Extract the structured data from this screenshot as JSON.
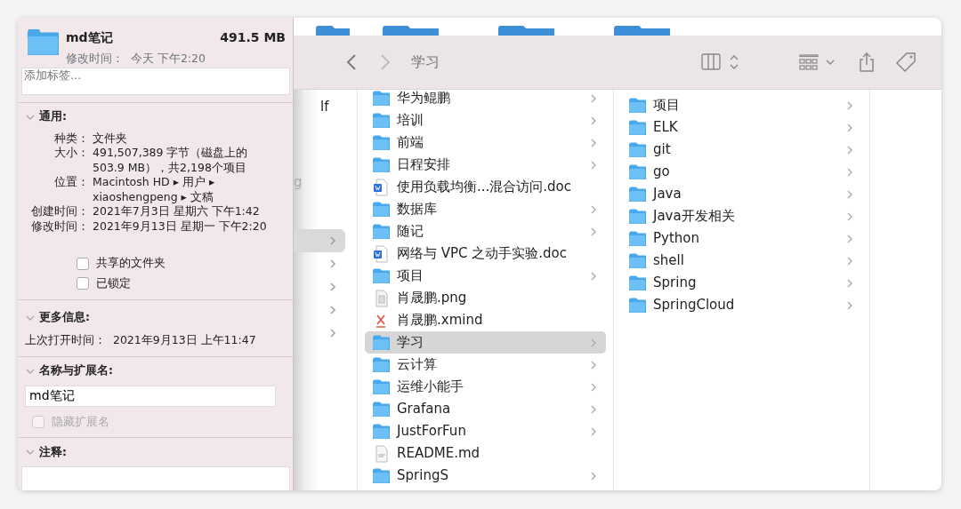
{
  "info_panel": {
    "name": "md笔记",
    "size": "491.5 MB",
    "modified": "修改时间：  今天 下午2:20",
    "tags": {
      "placeholder": "添加标签..."
    },
    "general": {
      "title": "通用:",
      "expanded": true,
      "fields": [
        {
          "label": "种类：",
          "value": "文件夹"
        },
        {
          "label": "大小：",
          "value": "491,507,389 字节（磁盘上的 503.9 MB），共2,198个项目"
        },
        {
          "label": "位置：",
          "value": "Macintosh HD ▸ 用户 ▸ xiaoshengpeng ▸ 文稿"
        },
        {
          "label": "创建时间：",
          "value": "2021年7月3日 星期六 下午1:42"
        },
        {
          "label": "修改时间：",
          "value": "2021年9月13日 星期一 下午2:20"
        }
      ],
      "checkboxes": [
        {
          "label": "共享的文件夹",
          "checked": false,
          "disabled": false
        },
        {
          "label": "已锁定",
          "checked": false,
          "disabled": false
        }
      ]
    },
    "more_info": {
      "title": "更多信息:",
      "expanded": true,
      "text": "上次打开时间：  2021年9月13日 上午11:47"
    },
    "name_extension": {
      "title": "名称与扩展名:",
      "expanded": true,
      "value": "md笔记",
      "checkbox": {
        "label": "隐藏扩展名",
        "checked": false,
        "disabled": true
      }
    },
    "comments": {
      "title": "注释:",
      "expanded": true
    }
  },
  "finder": {
    "toolbar": {
      "title": "学习"
    },
    "column_1": {
      "texts": [
        "lf",
        "g"
      ],
      "rows": [
        {
          "selected": true
        },
        {
          "selected": false
        },
        {
          "selected": false
        },
        {
          "selected": false
        },
        {
          "selected": false
        }
      ]
    },
    "column_2": [
      {
        "name": "华为鲲鹏",
        "kind": "folder",
        "selected": false
      },
      {
        "name": "培训",
        "kind": "folder",
        "selected": false
      },
      {
        "name": "前端",
        "kind": "folder",
        "selected": false
      },
      {
        "name": "日程安排",
        "kind": "folder",
        "selected": false
      },
      {
        "name": "使用负载均衡...混合访问.doc",
        "kind": "doc",
        "selected": false
      },
      {
        "name": "数据库",
        "kind": "folder",
        "selected": false
      },
      {
        "name": "随记",
        "kind": "folder",
        "selected": false
      },
      {
        "name": "网络与 VPC 之动手实验.doc",
        "kind": "doc",
        "selected": false
      },
      {
        "name": "项目",
        "kind": "folder",
        "selected": false
      },
      {
        "name": "肖晟鹏.png",
        "kind": "image",
        "selected": false
      },
      {
        "name": "肖晟鹏.xmind",
        "kind": "xmind",
        "selected": false
      },
      {
        "name": "学习",
        "kind": "folder",
        "selected": true
      },
      {
        "name": "云计算",
        "kind": "folder",
        "selected": false
      },
      {
        "name": "运维小能手",
        "kind": "folder",
        "selected": false
      },
      {
        "name": "Grafana",
        "kind": "folder",
        "selected": false
      },
      {
        "name": "JustForFun",
        "kind": "folder",
        "selected": false
      },
      {
        "name": "README.md",
        "kind": "text",
        "selected": false
      },
      {
        "name": "SpringS",
        "kind": "folder",
        "selected": false
      }
    ],
    "column_3": [
      {
        "name": "项目",
        "kind": "folder",
        "selected": false
      },
      {
        "name": "ELK",
        "kind": "folder",
        "selected": false
      },
      {
        "name": "git",
        "kind": "folder",
        "selected": false
      },
      {
        "name": "go",
        "kind": "folder",
        "selected": false
      },
      {
        "name": "Java",
        "kind": "folder",
        "selected": false
      },
      {
        "name": "Java开发相关",
        "kind": "folder",
        "selected": false
      },
      {
        "name": "Python",
        "kind": "folder",
        "selected": false
      },
      {
        "name": "shell",
        "kind": "folder",
        "selected": false
      },
      {
        "name": "Spring",
        "kind": "folder",
        "selected": false
      },
      {
        "name": "SpringCloud",
        "kind": "folder",
        "selected": false
      }
    ]
  }
}
